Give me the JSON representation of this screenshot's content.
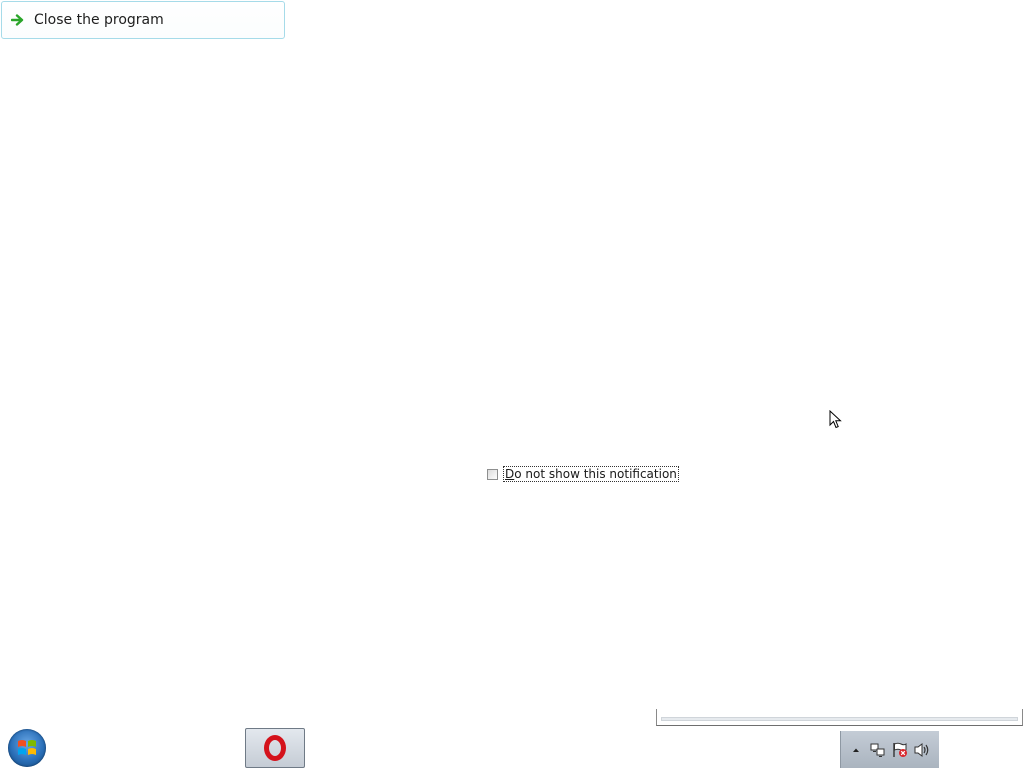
{
  "command_link": {
    "label": "Close the program",
    "icon": "green-arrow-right-icon",
    "border_color": "#a6dbe9",
    "arrow_color": "#2aa52a"
  },
  "notification_checkbox": {
    "label": "Do not show this notification",
    "checked": false
  },
  "taskbar": {
    "start_button": "windows-start-orb-icon",
    "pinned_apps": [
      {
        "name": "opera-icon",
        "color": "#d4121b"
      }
    ],
    "tray_icons": [
      "show-hidden-icons-chevron-icon",
      "network-icon",
      "action-center-flag-icon",
      "volume-icon"
    ]
  }
}
